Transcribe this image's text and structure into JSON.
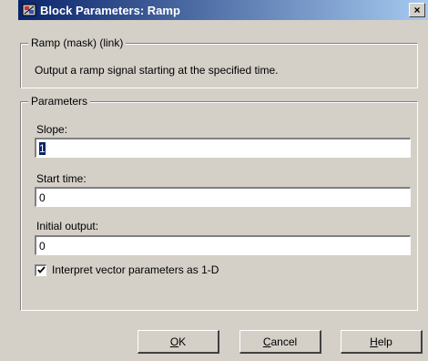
{
  "window": {
    "title": "Block Parameters: Ramp",
    "close_label": "×"
  },
  "mask_group": {
    "legend": "Ramp (mask) (link)",
    "description": "Output a ramp signal starting at the specified time."
  },
  "parameters": {
    "legend": "Parameters",
    "slope_label": "Slope:",
    "slope_value": "1",
    "start_time_label": "Start time:",
    "start_time_value": "0",
    "initial_output_label": "Initial output:",
    "initial_output_value": "0",
    "vector_checkbox_label": "Interpret vector parameters as 1-D",
    "vector_checkbox_checked": true
  },
  "buttons": {
    "ok_mnemonic": "O",
    "ok_rest": "K",
    "cancel_mnemonic": "C",
    "cancel_rest": "ancel",
    "help_mnemonic": "H",
    "help_rest": "elp"
  },
  "colors": {
    "titlebar_start": "#0a246a",
    "titlebar_end": "#a6caf0",
    "face": "#d4d0c8",
    "selection": "#0a246a"
  }
}
